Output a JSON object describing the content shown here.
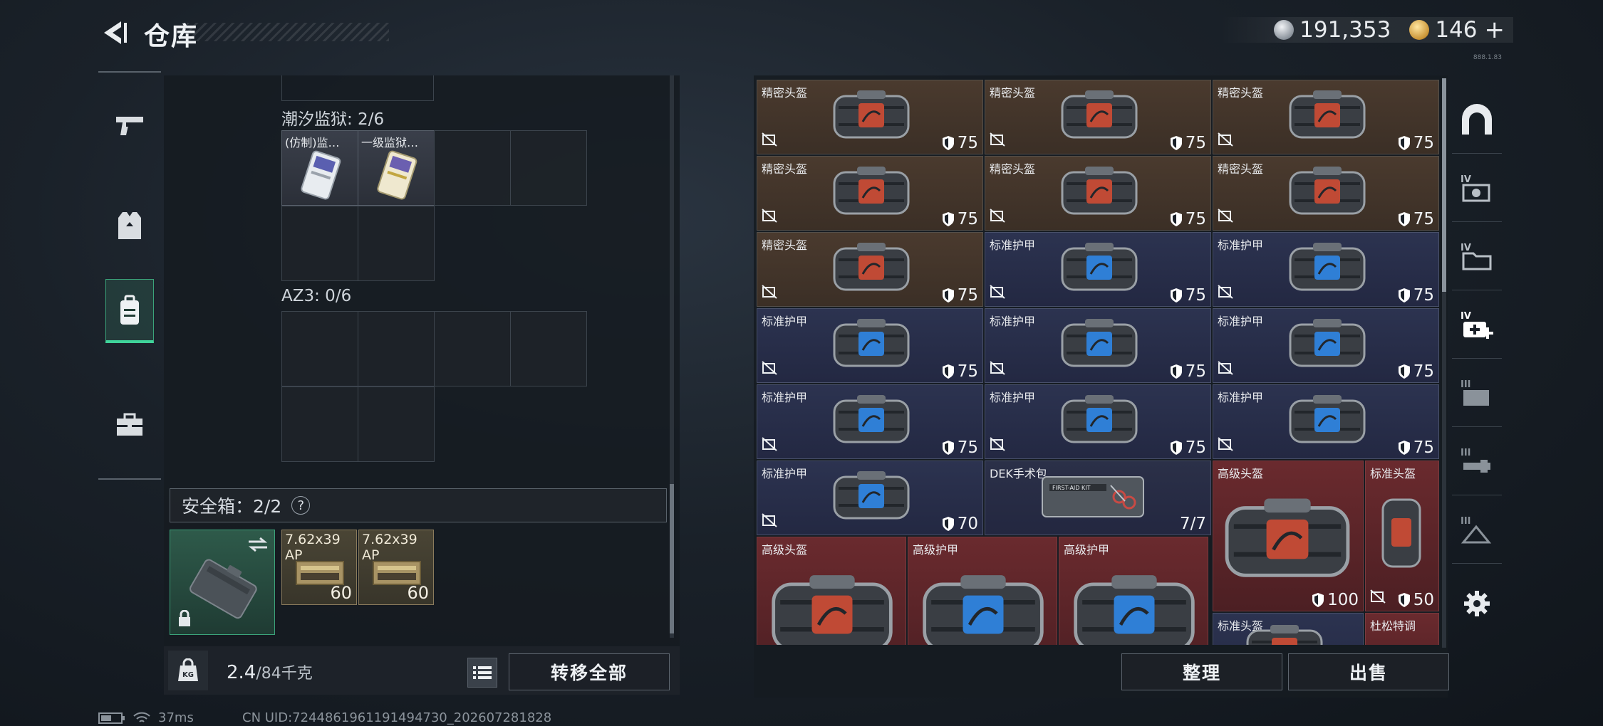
{
  "header": {
    "title": "仓库"
  },
  "currency": {
    "silver": "191,353",
    "gold": "146",
    "plus": "+"
  },
  "version_tag": "888.1.83",
  "left_panel": {
    "prison_label": "潮汐监狱: 2/6",
    "prison_items": [
      "(仿制)监…",
      "一级监狱…"
    ],
    "az3_label": "AZ3: 0/6",
    "safe_box": {
      "label": "安全箱：2/2",
      "help": "?"
    },
    "ammo": [
      {
        "name": "7.62x39 AP",
        "count": "60"
      },
      {
        "name": "7.62x39 AP",
        "count": "60"
      }
    ],
    "weight_value": "2.4",
    "weight_max": "/84千克",
    "transfer_all": "转移全部"
  },
  "right_panel": {
    "items": [
      {
        "label": "精密头盔",
        "durability": "75",
        "type": "helmet",
        "tier": "brown"
      },
      {
        "label": "精密头盔",
        "durability": "75",
        "type": "helmet",
        "tier": "brown"
      },
      {
        "label": "精密头盔",
        "durability": "75",
        "type": "helmet",
        "tier": "brown"
      },
      {
        "label": "精密头盔",
        "durability": "75",
        "type": "helmet",
        "tier": "brown"
      },
      {
        "label": "精密头盔",
        "durability": "75",
        "type": "helmet",
        "tier": "brown"
      },
      {
        "label": "精密头盔",
        "durability": "75",
        "type": "helmet",
        "tier": "brown"
      },
      {
        "label": "精密头盔",
        "durability": "75",
        "type": "helmet",
        "tier": "brown"
      },
      {
        "label": "标准护甲",
        "durability": "75",
        "type": "armor",
        "tier": "blue"
      },
      {
        "label": "标准护甲",
        "durability": "75",
        "type": "armor",
        "tier": "blue"
      },
      {
        "label": "标准护甲",
        "durability": "75",
        "type": "armor",
        "tier": "blue"
      },
      {
        "label": "标准护甲",
        "durability": "75",
        "type": "armor",
        "tier": "blue"
      },
      {
        "label": "标准护甲",
        "durability": "75",
        "type": "armor",
        "tier": "blue"
      },
      {
        "label": "标准护甲",
        "durability": "75",
        "type": "armor",
        "tier": "blue"
      },
      {
        "label": "标准护甲",
        "durability": "75",
        "type": "armor",
        "tier": "blue"
      },
      {
        "label": "标准护甲",
        "durability": "75",
        "type": "armor",
        "tier": "blue"
      },
      {
        "label": "标准护甲",
        "durability": "70",
        "type": "armor",
        "tier": "blue"
      }
    ],
    "dek": {
      "label": "DEK手术包",
      "count": "7/7",
      "kit_text": "FIRST-AID KIT"
    },
    "adv_helmet": {
      "label": "高级头盔",
      "durability": "100"
    },
    "std_helmet": {
      "label": "标准头盔",
      "durability": "50"
    },
    "bottom_row": [
      {
        "label": "高级头盔",
        "type": "helmet"
      },
      {
        "label": "高级护甲",
        "type": "armor"
      },
      {
        "label": "高级护甲",
        "type": "armor"
      }
    ],
    "partial": [
      "标准头盔",
      "杜松特调"
    ],
    "organize": "整理",
    "sell": "出售"
  },
  "status_bar": {
    "ping": "37ms",
    "uid": "CN UID:7244861961191494730_202607281828"
  },
  "colors": {
    "accent": "#3fd39a",
    "brown_tier": "#4a3a2e",
    "blue_tier": "#2c3350",
    "red_tier": "#6a2a2e"
  }
}
